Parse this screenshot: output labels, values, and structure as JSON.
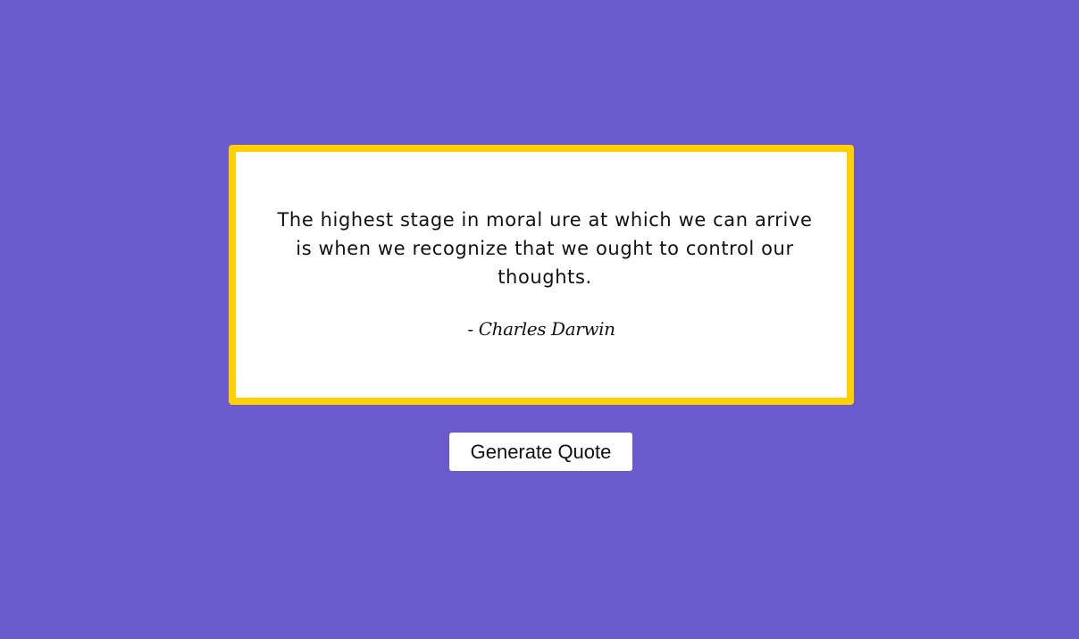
{
  "colors": {
    "background": "#6a5acd",
    "card_border": "#ffd000",
    "card_background": "#ffffff",
    "button_background": "#ffffff"
  },
  "quote": {
    "text": "The highest stage in moral ure at which we can arrive is when we recognize that we ought to control our thoughts.",
    "author": "- Charles Darwin"
  },
  "controls": {
    "generate_label": "Generate Quote"
  }
}
